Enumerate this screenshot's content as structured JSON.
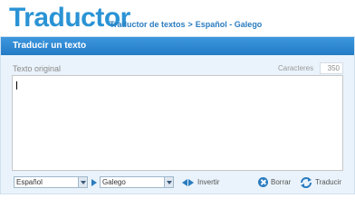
{
  "header": {
    "logo": "Traductor",
    "breadcrumb_section": "Traductor de textos",
    "breadcrumb_sep": ">",
    "breadcrumb_pair": "Español - Galego"
  },
  "panel": {
    "title": "Traducir un texto",
    "original_label": "Texto original",
    "chars_label": "Caracteres",
    "chars_count": "350",
    "text_value": ""
  },
  "controls": {
    "source_language": "Español",
    "target_language": "Galego",
    "invert_label": "Invertir",
    "clear_label": "Borrar",
    "translate_label": "Traducir"
  },
  "icons": {
    "swap": "invert-arrows-icon",
    "direction": "play-arrow-icon",
    "clear": "close-circle-icon",
    "translate": "refresh-arrows-icon"
  },
  "colors": {
    "brand": "#2a93d5",
    "panel_header": "#237bc6",
    "panel_bg": "#eaf3fb"
  }
}
